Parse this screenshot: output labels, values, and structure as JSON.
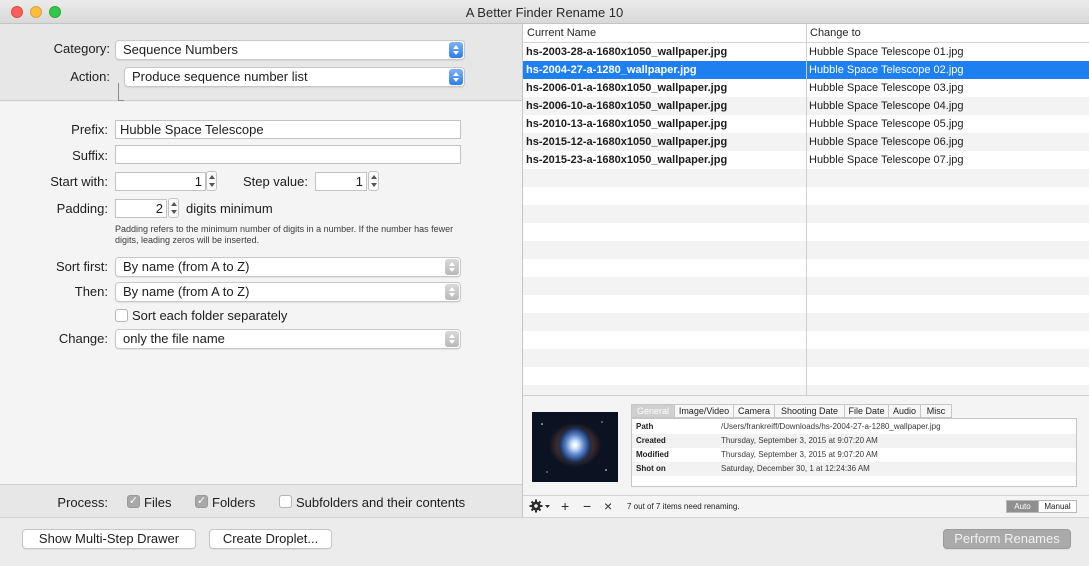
{
  "window": {
    "title": "A Better Finder Rename 10"
  },
  "left": {
    "category_label": "Category:",
    "category_value": "Sequence Numbers",
    "action_label": "Action:",
    "action_value": "Produce sequence number list",
    "prefix_label": "Prefix:",
    "prefix_value": "Hubble Space Telescope",
    "suffix_label": "Suffix:",
    "suffix_value": "",
    "start_label": "Start with:",
    "start_value": "1",
    "step_label": "Step value:",
    "step_value": "1",
    "padding_label": "Padding:",
    "padding_value": "2",
    "padding_suffix": "digits minimum",
    "padding_hint_line1": "Padding refers to the minimum number of digits in a number. If the number has fewer",
    "padding_hint_line2": "digits, leading zeros will be inserted.",
    "sort_first_label": "Sort first:",
    "sort_first_value": "By name (from A to Z)",
    "then_label": "Then:",
    "then_value": "By name (from A to Z)",
    "sort_each_folder_label": "Sort each folder separately",
    "sort_each_folder_checked": false,
    "change_label": "Change:",
    "change_value": "only the file name",
    "process_label": "Process:",
    "files_label": "Files",
    "files_checked": true,
    "folders_label": "Folders",
    "folders_checked": true,
    "subfolders_label": "Subfolders and their contents",
    "subfolders_checked": false
  },
  "bottom": {
    "multistep_label": "Show Multi-Step Drawer",
    "droplet_label": "Create Droplet...",
    "perform_label": "Perform Renames"
  },
  "table": {
    "col_current": "Current Name",
    "col_change": "Change to",
    "rows": [
      {
        "current": "hs-2003-28-a-1680x1050_wallpaper.jpg",
        "change": "Hubble Space Telescope 01.jpg"
      },
      {
        "current": "hs-2004-27-a-1280_wallpaper.jpg",
        "change": "Hubble Space Telescope 02.jpg"
      },
      {
        "current": "hs-2006-01-a-1680x1050_wallpaper.jpg",
        "change": "Hubble Space Telescope 03.jpg"
      },
      {
        "current": "hs-2006-10-a-1680x1050_wallpaper.jpg",
        "change": "Hubble Space Telescope 04.jpg"
      },
      {
        "current": "hs-2010-13-a-1680x1050_wallpaper.jpg",
        "change": "Hubble Space Telescope 05.jpg"
      },
      {
        "current": "hs-2015-12-a-1680x1050_wallpaper.jpg",
        "change": "Hubble Space Telescope 06.jpg"
      },
      {
        "current": "hs-2015-23-a-1680x1050_wallpaper.jpg",
        "change": "Hubble Space Telescope 07.jpg"
      }
    ],
    "selected_row": 1
  },
  "preview": {
    "tabs": [
      "General",
      "Image/Video",
      "Camera",
      "Shooting Date",
      "File Date",
      "Audio",
      "Misc"
    ],
    "active_tab": "General",
    "info": [
      {
        "key": "Path",
        "value": "/Users/frankreiff/Downloads/hs-2004-27-a-1280_wallpaper.jpg"
      },
      {
        "key": "Created",
        "value": "Thursday, September 3, 2015 at 9:07:20 AM"
      },
      {
        "key": "Modified",
        "value": "Thursday, September 3, 2015 at 9:07:20 AM"
      },
      {
        "key": "Shot on",
        "value": "Saturday, December 30, 1 at 12:24:36 AM"
      }
    ]
  },
  "toolbar": {
    "status": "7 out of 7 items need renaming.",
    "auto_label": "Auto",
    "manual_label": "Manual",
    "mode": "Auto",
    "icons": [
      "gear-icon",
      "plus-icon",
      "minus-icon",
      "clear-icon"
    ]
  },
  "colors": {
    "selection": "#1e7ff0",
    "popup_arrow": "#2e7ce8",
    "close": "#fc605c",
    "minimize": "#fdbc40",
    "maximize": "#34c84a"
  }
}
